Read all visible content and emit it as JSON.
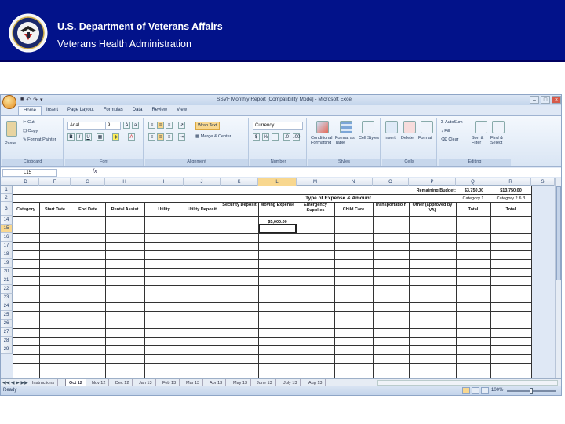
{
  "banner": {
    "agency": "U.S. Department of Veterans Affairs",
    "subagency": "Veterans Health Administration",
    "seal_icon": "va-seal-icon"
  },
  "excel": {
    "window_title": "SSVF Monthly Report  [Compatibility Mode] - Microsoft Excel",
    "tabs": [
      "Home",
      "Insert",
      "Page Layout",
      "Formulas",
      "Data",
      "Review",
      "View"
    ],
    "active_tab": "Home",
    "ribbon": {
      "clipboard": {
        "label": "Clipboard",
        "paste": "Paste",
        "cut": "Cut",
        "copy": "Copy",
        "format_painter": "Format Painter"
      },
      "font": {
        "label": "Font",
        "name": "Arial",
        "size": "9"
      },
      "alignment": {
        "label": "Alignment",
        "wrap": "Wrap Text",
        "merge": "Merge & Center"
      },
      "number": {
        "label": "Number",
        "format": "Currency"
      },
      "styles": {
        "label": "Styles",
        "conditional": "Conditional Formatting",
        "format_table": "Format as Table",
        "cell_styles": "Cell Styles"
      },
      "cells": {
        "label": "Cells",
        "insert": "Insert",
        "delete": "Delete",
        "format": "Format"
      },
      "editing": {
        "label": "Editing",
        "autosum": "AutoSum",
        "fill": "Fill",
        "clear": "Clear",
        "sort": "Sort & Filter",
        "find": "Find & Select"
      }
    },
    "name_box": "L15",
    "fx": "fx",
    "columns": [
      "D",
      "F",
      "G",
      "H",
      "I",
      "J",
      "K",
      "L",
      "M",
      "N",
      "O",
      "P",
      "Q",
      "R",
      "S"
    ],
    "selected_column": "L",
    "rows": [
      "1",
      "2",
      "3",
      "14",
      "15",
      "16",
      "17",
      "18",
      "19",
      "20",
      "21",
      "22",
      "23",
      "24",
      "25",
      "26",
      "27",
      "28",
      "29"
    ],
    "selected_row": "15",
    "sheet": {
      "remaining_budget_label": "Remaining Budget:",
      "budget_cat1": "$3,750.00",
      "budget_cat23": "$13,750.00",
      "cat1_label": "Category 1",
      "cat23_label": "Category 2 & 3",
      "section_header": "Type of Expense & Amount",
      "headers": [
        "Category",
        "Start Date",
        "End Date",
        "Rental Assist",
        "Utility",
        "Utility Deposit",
        "Security Deposit",
        "Moving Expense",
        "Emergency Supplies",
        "Child Care",
        "Transportatio n",
        "Other (approved by VA)",
        "Total",
        "Total"
      ],
      "moving_amount": "$5,000.00"
    },
    "sheet_tabs": [
      "Instructions",
      "Oct 12",
      "Nov 12",
      "Dec 12",
      "Jan 13",
      "Feb 13",
      "Mar 13",
      "Apr 13",
      "May 13",
      "June 13",
      "July 13",
      "Aug 13"
    ],
    "active_sheet": "Oct 12",
    "status": "Ready",
    "zoom": "100%"
  }
}
